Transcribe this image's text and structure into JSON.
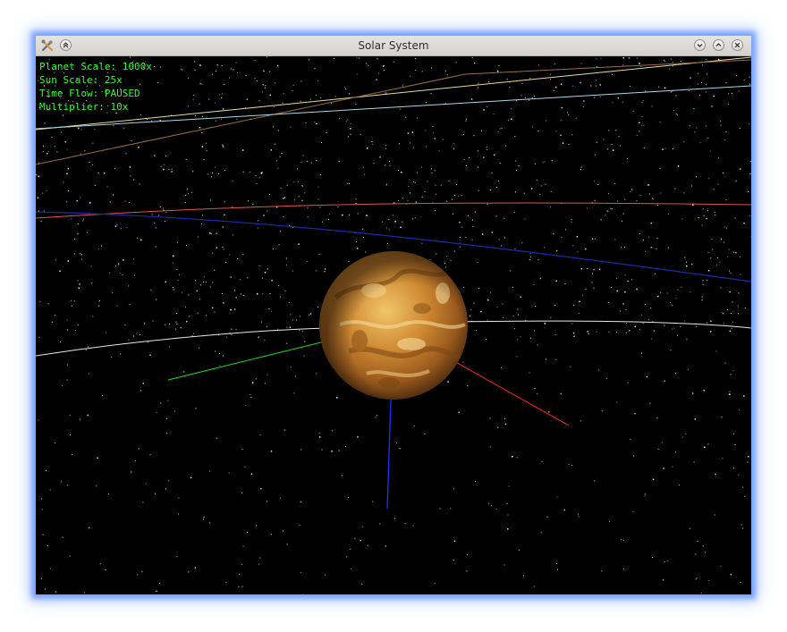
{
  "window": {
    "title": "Solar System"
  },
  "titlebar_icons": {
    "app": "tools-icon",
    "shade": "shade-icon",
    "minimize": "minimize-icon",
    "maximize": "maximize-icon",
    "close": "close-icon"
  },
  "hud": {
    "planet_scale": "Planet Scale: 1000x",
    "sun_scale": "Sun Scale: 25x",
    "time_flow": "Time Flow: PAUSED",
    "multiplier": "Multiplier: 10x"
  },
  "colors": {
    "hud_text": "#2cff2c",
    "axis_x": "#ff2020",
    "axis_y": "#20dd20",
    "axis_z": "#2030ff",
    "planet": "#c8852e"
  }
}
